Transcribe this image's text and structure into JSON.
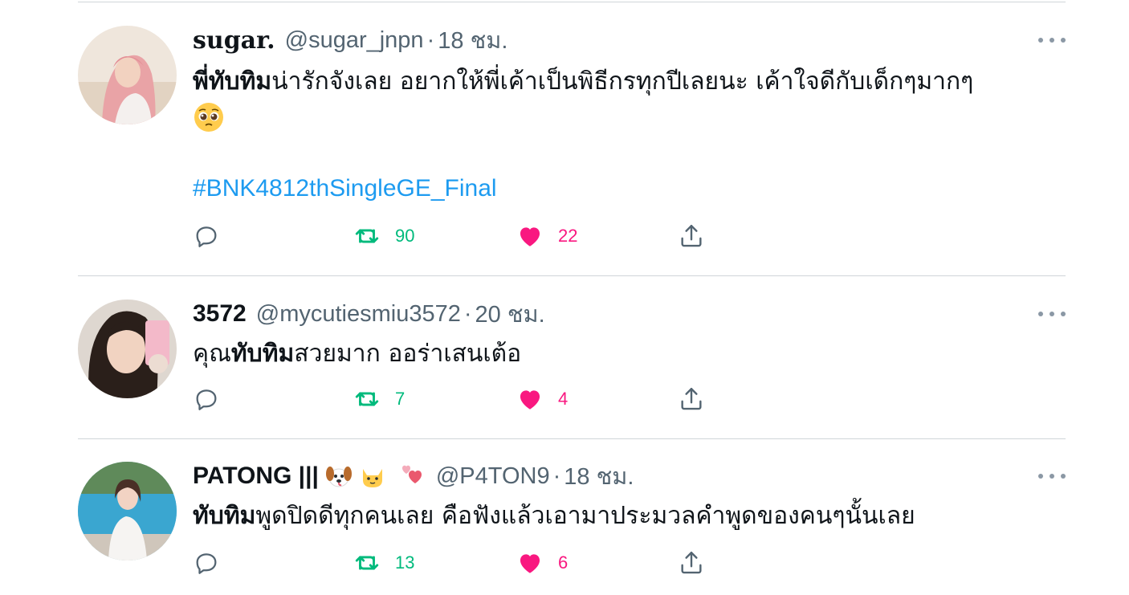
{
  "tweets": [
    {
      "display_name": "sugar.",
      "handle": "@sugar_jnpn",
      "separator": "·",
      "time": "18 ชม.",
      "text_bold": "พี่ทับทิม",
      "text_rest": "น่ารักจังเลย อยากให้พี่เค้าเป็นพิธีกรทุกปีเลยนะ เค้าใจดีกับเด็กๆมากๆ",
      "text_emoji": "pleading-face-emoji",
      "hashtag": "#BNK4812thSingleGE_Final",
      "retweets": "90",
      "likes": "22"
    },
    {
      "display_name": "3572",
      "handle": "@mycutiesmiu3572",
      "separator": "·",
      "time": "20 ชม.",
      "text_prefix": "คุณ",
      "text_bold": "ทับทิม",
      "text_rest": "สวยมาก ออร่าเสนเต้อ",
      "retweets": "7",
      "likes": "4"
    },
    {
      "display_name": "PATONG |||",
      "name_emojis": [
        "dog-face-emoji",
        "cat-face-emoji",
        "two-hearts-emoji"
      ],
      "handle": "@P4TON9",
      "separator": "·",
      "time": "18 ชม.",
      "text_bold": "ทับทิม",
      "text_rest": "พูดปิดดีทุกคนเลย คือฟังแล้วเอามาประมวลคำพูดของคนๆนั้นเลย",
      "retweets": "13",
      "likes": "6"
    }
  ],
  "icons": {
    "reply": "reply-icon",
    "retweet": "retweet-icon",
    "like": "heart-icon",
    "share": "share-icon",
    "more": "more-icon"
  },
  "colors": {
    "retweet": "#00ba7c",
    "like": "#f91880",
    "hashtag": "#1d9bf0",
    "secondary_text": "#536471"
  }
}
